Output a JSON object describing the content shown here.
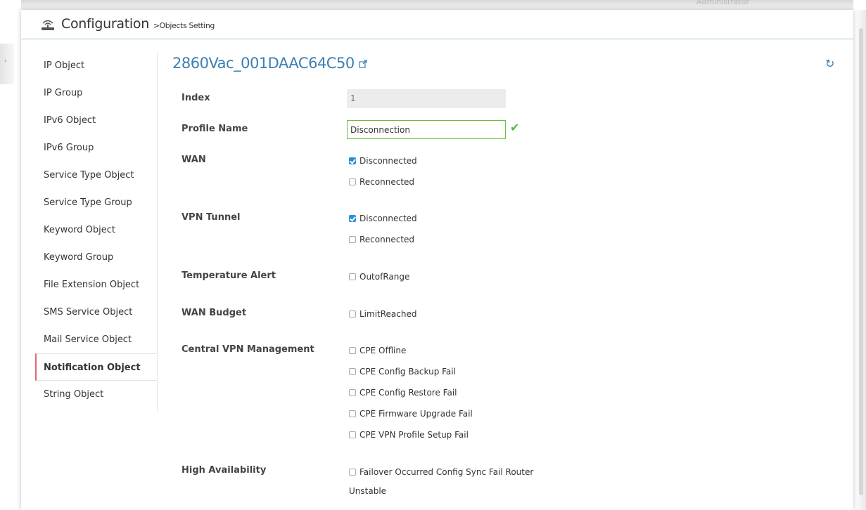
{
  "topbar": {
    "user_label": "Administrator"
  },
  "header": {
    "title": "Configuration",
    "subtitle": ">Objects Setting"
  },
  "sidebar": {
    "items": [
      {
        "label": "IP Object"
      },
      {
        "label": "IP Group"
      },
      {
        "label": "IPv6 Object"
      },
      {
        "label": "IPv6 Group"
      },
      {
        "label": "Service Type Object"
      },
      {
        "label": "Service Type Group"
      },
      {
        "label": "Keyword Object"
      },
      {
        "label": "Keyword Group"
      },
      {
        "label": "File Extension Object"
      },
      {
        "label": "SMS Service Object"
      },
      {
        "label": "Mail Service Object"
      },
      {
        "label": "Notification Object"
      },
      {
        "label": "String Object"
      }
    ],
    "active": "Notification Object"
  },
  "device": {
    "name": "2860Vac_001DAAC64C50"
  },
  "form": {
    "index": {
      "label": "Index",
      "value": "1"
    },
    "profile_name": {
      "label": "Profile Name",
      "value": "Disconnection"
    },
    "wan": {
      "label": "WAN",
      "options": [
        {
          "label": "Disconnected",
          "checked": true
        },
        {
          "label": "Reconnected",
          "checked": false
        }
      ]
    },
    "vpn_tunnel": {
      "label": "VPN Tunnel",
      "options": [
        {
          "label": "Disconnected",
          "checked": true
        },
        {
          "label": "Reconnected",
          "checked": false
        }
      ]
    },
    "temperature_alert": {
      "label": "Temperature Alert",
      "options": [
        {
          "label": "OutofRange",
          "checked": false
        }
      ]
    },
    "wan_budget": {
      "label": "WAN Budget",
      "options": [
        {
          "label": "LimitReached",
          "checked": false
        }
      ]
    },
    "central_vpn": {
      "label": "Central VPN Management",
      "options": [
        {
          "label": "CPE Offline",
          "checked": false
        },
        {
          "label": "CPE Config Backup Fail",
          "checked": false
        },
        {
          "label": "CPE Config Restore Fail",
          "checked": false
        },
        {
          "label": "CPE Firmware Upgrade Fail",
          "checked": false
        },
        {
          "label": "CPE VPN Profile Setup Fail",
          "checked": false
        }
      ]
    },
    "high_availability": {
      "label": "High Availability",
      "option_line1": "Failover Occurred Config Sync Fail Router",
      "option_line2": "Unstable",
      "checked": false
    }
  },
  "colors": {
    "accent": "#3a7fb3",
    "checkbox_on": "#2b8fd6",
    "valid": "#58b43a",
    "active_marker": "#e06a66"
  }
}
